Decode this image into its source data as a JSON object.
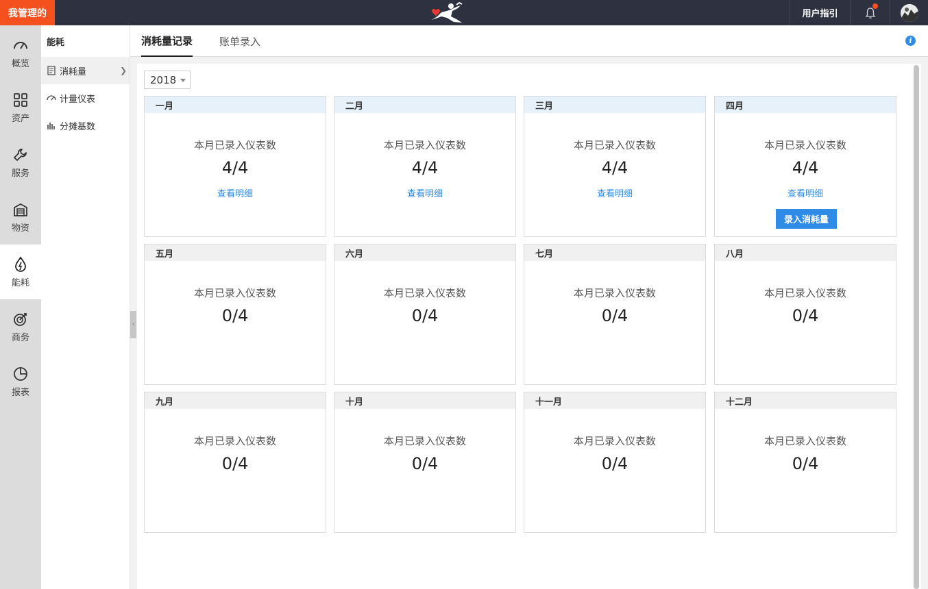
{
  "topbar": {
    "brand_label": "我管理的",
    "logo_icon": "runner-logo-icon",
    "guide_label": "用户指引",
    "bell_icon": "bell-icon",
    "notification_color": "#f4511e",
    "brand_color": "#f4511e"
  },
  "leftnav": {
    "items": [
      {
        "label": "概览",
        "icon": "gauge-icon"
      },
      {
        "label": "资产",
        "icon": "grid-icon"
      },
      {
        "label": "服务",
        "icon": "wrench-icon"
      },
      {
        "label": "物资",
        "icon": "warehouse-icon"
      },
      {
        "label": "能耗",
        "icon": "energy-icon",
        "active": true
      },
      {
        "label": "商务",
        "icon": "target-icon"
      },
      {
        "label": "报表",
        "icon": "pie-chart-icon"
      }
    ]
  },
  "subnav": {
    "title": "能耗",
    "items": [
      {
        "label": "消耗量",
        "icon": "document-icon",
        "active": true
      },
      {
        "label": "计量仪表",
        "icon": "meter-icon"
      },
      {
        "label": "分摊基数",
        "icon": "bar-icon"
      }
    ]
  },
  "tabs": [
    {
      "label": "消耗量记录",
      "active": true
    },
    {
      "label": "账单录入"
    }
  ],
  "year": "2018",
  "accent_color": "#2e8be6",
  "card_label": "本月已录入仪表数",
  "detail_link": "查看明细",
  "record_button": "录入消耗量",
  "months": [
    {
      "name": "一月",
      "count": "4/4",
      "detail": true
    },
    {
      "name": "二月",
      "count": "4/4",
      "detail": true
    },
    {
      "name": "三月",
      "count": "4/4",
      "detail": true
    },
    {
      "name": "四月",
      "count": "4/4",
      "detail": true,
      "button": true
    },
    {
      "name": "五月",
      "count": "0/4"
    },
    {
      "name": "六月",
      "count": "0/4"
    },
    {
      "name": "七月",
      "count": "0/4"
    },
    {
      "name": "八月",
      "count": "0/4"
    },
    {
      "name": "九月",
      "count": "0/4"
    },
    {
      "name": "十月",
      "count": "0/4"
    },
    {
      "name": "十一月",
      "count": "0/4"
    },
    {
      "name": "十二月",
      "count": "0/4"
    }
  ]
}
